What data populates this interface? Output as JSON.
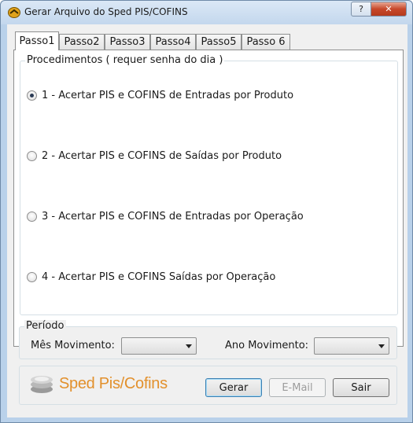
{
  "window": {
    "title": "Gerar Arquivo do Sped PIS/COFINS",
    "help_label": "?",
    "close_label": "✕"
  },
  "tabs": [
    {
      "label": "Passo1",
      "active": true
    },
    {
      "label": "Passo2",
      "active": false
    },
    {
      "label": "Passo3",
      "active": false
    },
    {
      "label": "Passo4",
      "active": false
    },
    {
      "label": "Passo5",
      "active": false
    },
    {
      "label": "Passo 6",
      "active": false
    }
  ],
  "procedimentos": {
    "legend": "Procedimentos ( requer senha do dia )",
    "options": [
      {
        "label": "1 - Acertar PIS e COFINS de Entradas por Produto",
        "checked": true
      },
      {
        "label": "2 - Acertar PIS e COFINS de Saídas por Produto",
        "checked": false
      },
      {
        "label": "3 - Acertar PIS e COFINS de Entradas por Operação",
        "checked": false
      },
      {
        "label": "4 - Acertar PIS e COFINS Saídas por Operação",
        "checked": false
      }
    ]
  },
  "periodo": {
    "legend": "Período",
    "mes_label": "Mês Movimento:",
    "mes_value": "",
    "ano_label": "Ano Movimento:",
    "ano_value": ""
  },
  "footer": {
    "logo_text": "Sped Pis/Cofins",
    "gerar_label": "Gerar",
    "email_label": "E-Mail",
    "sair_label": "Sair"
  },
  "colors": {
    "logo_orange": "#e2902c",
    "close_red": "#c7482a"
  }
}
